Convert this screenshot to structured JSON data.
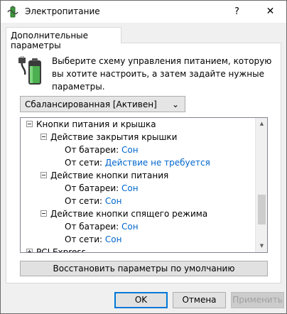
{
  "window": {
    "title": "Электропитание",
    "help_label": "?",
    "close_label": "✕"
  },
  "tab": {
    "label": "Дополнительные параметры"
  },
  "description": "Выберите схему управления питанием, которую вы хотите настроить, а затем задайте нужные параметры.",
  "plan_select": {
    "value": "Сбалансированная [Активен]"
  },
  "tree": {
    "power_buttons_lid": "Кнопки питания и крышка",
    "lid_close_action": {
      "label": "Действие закрытия крышки",
      "on_battery_label": "От батареи:",
      "on_battery_value": "Сон",
      "plugged_in_label": "От сети:",
      "plugged_in_value": "Действие не требуется"
    },
    "power_button_action": {
      "label": "Действие кнопки питания",
      "on_battery_label": "От батареи:",
      "on_battery_value": "Сон",
      "plugged_in_label": "От сети:",
      "plugged_in_value": "Сон"
    },
    "sleep_button_action": {
      "label": "Действие кнопки спящего режима",
      "on_battery_label": "От батареи:",
      "on_battery_value": "Сон",
      "plugged_in_label": "От сети:",
      "plugged_in_value": "Сон"
    },
    "pci_express": "PCI Express"
  },
  "restore_button": "Восстановить параметры по умолчанию",
  "buttons": {
    "ok": "OK",
    "cancel": "Отмена",
    "apply": "Применить"
  },
  "colors": {
    "value_link": "#0066cc",
    "accent": "#0078d7"
  }
}
